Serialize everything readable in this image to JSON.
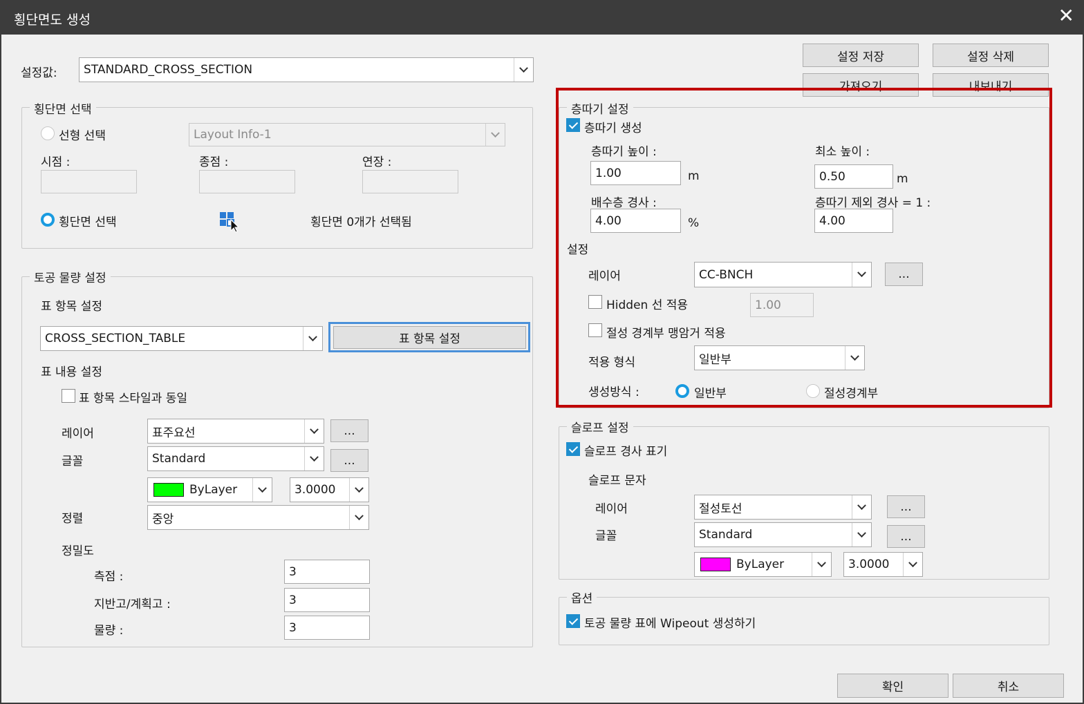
{
  "window": {
    "title": "횡단면도 생성"
  },
  "top": {
    "setting_label": "설정값:",
    "setting_value": "STANDARD_CROSS_SECTION",
    "buttons": {
      "save": "설정 저장",
      "delete": "설정 삭제",
      "import": "가져오기",
      "export": "내보내기"
    }
  },
  "cross_select": {
    "legend": "횡단면 선택",
    "linear_label": "선형 선택",
    "layout_value": "Layout Info-1",
    "start_label": "시점 :",
    "end_label": "종점 :",
    "extend_label": "연장 :",
    "section_label": "횡단면 선택",
    "status": "횡단면 0개가 선택됨"
  },
  "earthwork": {
    "legend": "토공 물량 설정",
    "table_item_label": "표 항목 설정",
    "table_value": "CROSS_SECTION_TABLE",
    "table_button": "표 항목 설정",
    "content_label": "표 내용 설정",
    "same_style_label": "표 항목 스타일과 동일",
    "layer_label": "레이어",
    "layer_value": "표주요선",
    "font_label": "글꼴",
    "font_value": "Standard",
    "color_value": "ByLayer",
    "color_hex": "#00ff00",
    "size_value": "3.0000",
    "align_label": "정렬",
    "align_value": "중앙",
    "precision_label": "정밀도",
    "station_label": "측점 :",
    "station_value": "3",
    "ground_label": "지반고/계획고 :",
    "ground_value": "3",
    "quantity_label": "물량 :",
    "quantity_value": "3",
    "ellipsis": "..."
  },
  "bench": {
    "legend": "층따기 설정",
    "create_label": "층따기 생성",
    "height_label": "층따기 높이 :",
    "height_value": "1.00",
    "height_unit": "m",
    "min_height_label": "최소 높이 :",
    "min_height_value": "0.50",
    "min_height_unit": "m",
    "drain_label": "배수층 경사 :",
    "drain_value": "4.00",
    "drain_unit": "%",
    "exclude_label": "층따기 제외 경사 = 1 :",
    "exclude_value": "4.00",
    "settings_label": "설정",
    "layer_label": "레이어",
    "layer_value": "CC-BNCH",
    "hidden_label": "Hidden 선 적용",
    "hidden_value": "1.00",
    "cutfill_label": "절성 경계부 맹암거 적용",
    "apply_type_label": "적용 형식",
    "apply_type_value": "일반부",
    "method_label": "생성방식 :",
    "method_general": "일반부",
    "method_boundary": "절성경계부",
    "ellipsis": "..."
  },
  "slope": {
    "legend": "슬로프 설정",
    "show_label": "슬로프 경사 표기",
    "text_label": "슬로프 문자",
    "layer_label": "레이어",
    "layer_value": "절성토선",
    "font_label": "글꼴",
    "font_value": "Standard",
    "color_value": "ByLayer",
    "color_hex": "#ff00ff",
    "size_value": "3.0000",
    "ellipsis": "..."
  },
  "options": {
    "legend": "옵션",
    "wipeout_label": "토공 물량 표에 Wipeout 생성하기"
  },
  "footer": {
    "ok": "확인",
    "cancel": "취소"
  }
}
